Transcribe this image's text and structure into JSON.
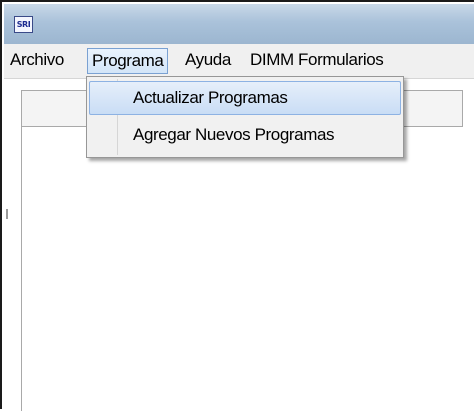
{
  "window": {
    "icon_name": "app-logo-icon",
    "icon_text": "SRI"
  },
  "menubar": {
    "items": [
      {
        "label": "Archivo",
        "open": false
      },
      {
        "label": "Programa",
        "open": true
      },
      {
        "label": "Ayuda",
        "open": false
      },
      {
        "label": "DIMM Formularios",
        "open": false
      }
    ]
  },
  "programa_menu": {
    "items": [
      {
        "label": "Actualizar Programas",
        "highlighted": true
      },
      {
        "label": "Agregar Nuevos Programas",
        "highlighted": false
      }
    ]
  },
  "colors": {
    "titlebar": "#aac2da",
    "menu_highlight_border": "#7aa1d2",
    "menu_highlight_fill": "#d3e5f8"
  }
}
